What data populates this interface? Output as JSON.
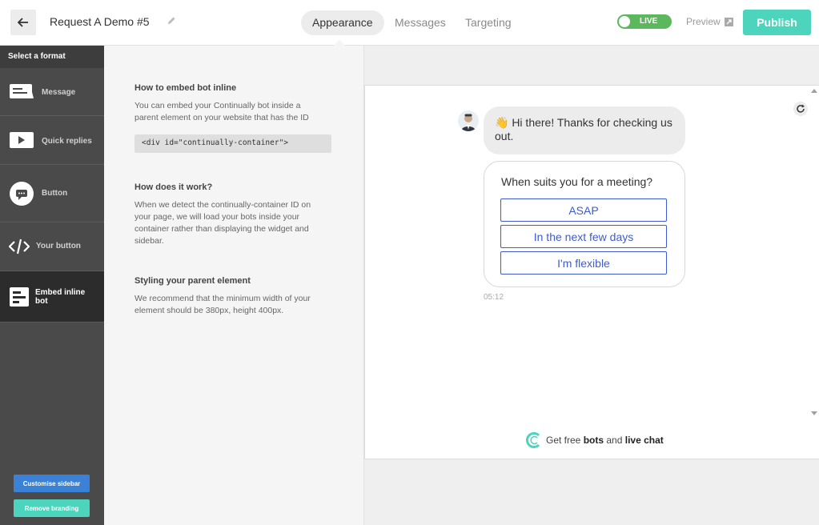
{
  "header": {
    "title": "Request A Demo #5",
    "tabs": [
      {
        "label": "Appearance"
      },
      {
        "label": "Messages"
      },
      {
        "label": "Targeting"
      }
    ],
    "live_label": "LIVE",
    "preview_label": "Preview",
    "publish_label": "Publish"
  },
  "sidebar": {
    "header": "Select a format",
    "items": [
      {
        "label": "Message"
      },
      {
        "label": "Quick replies"
      },
      {
        "label": "Button"
      },
      {
        "label": "Your button"
      },
      {
        "label": "Embed inline bot"
      }
    ],
    "customise_label": "Customise sidebar",
    "remove_branding_label": "Remove branding"
  },
  "content": {
    "section1_title": "How to embed bot inline",
    "section1_text": "You can embed your Continually bot inside a parent element on your website that has the ID",
    "code": "<div id=\"continually-container\">",
    "section2_title": "How does it work?",
    "section2_text": "When we detect the continually-container ID on your page, we will load your bots inside your container rather than displaying the widget and sidebar.",
    "section3_title": "Styling your parent element",
    "section3_text": "We recommend that the minimum width of your element should be 380px, height 400px."
  },
  "chat": {
    "greeting": "👋 Hi there! Thanks for checking us out.",
    "question": "When suits you for a meeting?",
    "options": [
      "ASAP",
      "In the next few days",
      "I'm flexible"
    ],
    "timestamp": "05:12",
    "branding_prefix": "Get free ",
    "branding_bots": "bots",
    "branding_and": " and ",
    "branding_chat": "live chat"
  },
  "colors": {
    "accent": "#4dd4bc",
    "live": "#5cb85c",
    "option_border": "#3d5bd3",
    "customise_button": "#3b82d6",
    "sidebar_bg": "#4a4a4a"
  }
}
